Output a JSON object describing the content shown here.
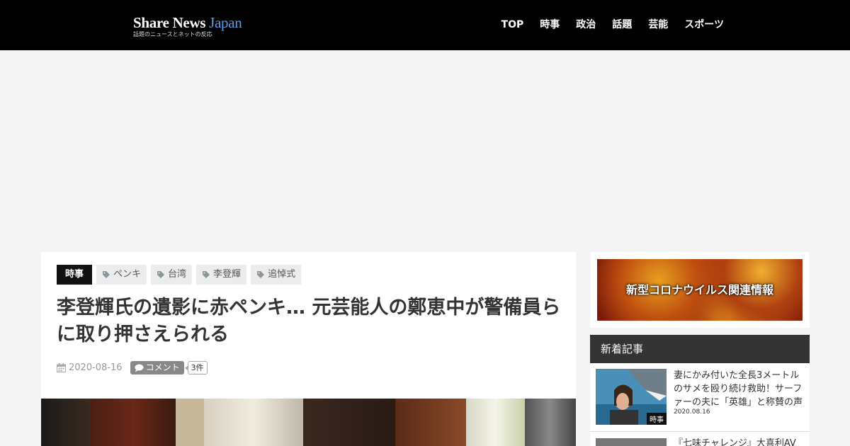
{
  "header": {
    "logo_main": "Share News",
    "logo_accent": "Japan",
    "logo_sub": "話題のニュースとネットの反応",
    "nav": [
      "TOP",
      "時事",
      "政治",
      "話題",
      "芸能",
      "スポーツ"
    ]
  },
  "article": {
    "category": "時事",
    "tags": [
      "ペンキ",
      "台湾",
      "李登輝",
      "追悼式"
    ],
    "title": "李登輝氏の遺影に赤ペンキ… 元芸能人の鄭恵中が警備員らに取り押さえられる",
    "date": "2020-08-16",
    "comment_label": "コメント",
    "comment_count": "3件"
  },
  "sidebar": {
    "corona_banner": "新型コロナウイルス関連情報",
    "new_header": "新着記事",
    "new_items": [
      {
        "title": "妻にかみ付いた全長3メートルのサメを殴り続け救助！サーファーの夫に「英雄」と称賛の声",
        "date": "2020.08.16",
        "badge": "時事"
      },
      {
        "title": "『七味チャレンジ』大喜利AV",
        "date": "",
        "badge": ""
      }
    ]
  },
  "colors": {
    "header_bg": "#000000",
    "logo_accent": "#5aa0e6",
    "category_badge": "#111111",
    "sidebar_header": "#333333"
  }
}
